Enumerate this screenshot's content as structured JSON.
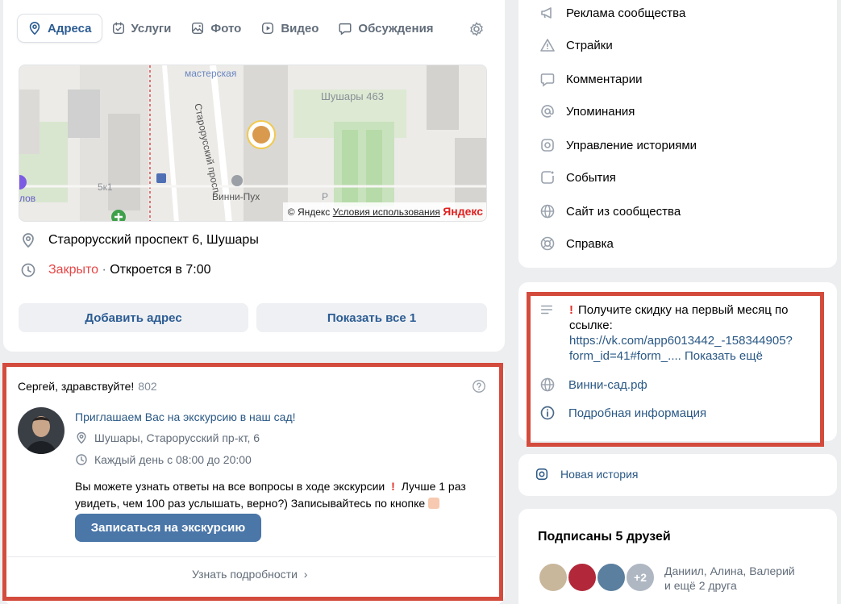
{
  "tabs": [
    {
      "label": "Адреса",
      "icon": "location-pin-icon",
      "active": true
    },
    {
      "label": "Услуги",
      "icon": "calendar-check-icon"
    },
    {
      "label": "Фото",
      "icon": "photo-icon"
    },
    {
      "label": "Видео",
      "icon": "video-play-icon"
    },
    {
      "label": "Обсуждения",
      "icon": "chat-bubble-icon"
    }
  ],
  "map": {
    "labels": {
      "workshop": "мастерская",
      "street": "Старорусский просп.",
      "district": "Шушары 463",
      "building": "5к1",
      "place": "Винни-Пух",
      "left_fragment": "лов",
      "parking": "P"
    },
    "attribution": {
      "copyright": "© Яндекс",
      "terms": "Условия использования",
      "brand": "Яндекс"
    }
  },
  "address": {
    "street": "Старорусский проспект 6, Шушары",
    "status_closed": "Закрыто",
    "status_sep": " · ",
    "status_open": "Откроется в 7:00",
    "add_button": "Добавить адрес",
    "show_all_button": "Показать все 1"
  },
  "widget": {
    "greeting": "Сергей, здравствуйте!",
    "count": "802",
    "invite": "Приглашаем Вас на экскурсию в наш сад!",
    "location": "Шушары, Старорусский пр-кт, 6",
    "schedule": "Каждый день с 08:00 до 20:00",
    "body_line1": "Вы можете узнать ответы на все вопросы в ходе экскурсии",
    "body_line1b": "Лучше 1 раз",
    "body_line2": "увидеть, чем 100 раз услышать, верно?) Записывайтесь по кнопке",
    "cta_button": "Записаться на экскурсию",
    "more_link": "Узнать подробности"
  },
  "menu": [
    {
      "label": "Реклама сообщества",
      "icon": "megaphone-icon"
    },
    {
      "label": "Страйки",
      "icon": "warning-triangle-icon"
    },
    {
      "label": "Комментарии",
      "icon": "comment-icon"
    },
    {
      "label": "Упоминания",
      "icon": "at-sign-icon"
    },
    {
      "label": "Управление историями",
      "icon": "stories-icon"
    },
    {
      "label": "События",
      "icon": "events-icon"
    },
    {
      "label": "Сайт из сообщества",
      "icon": "globe-icon"
    },
    {
      "label": "Справка",
      "icon": "lifebuoy-icon"
    }
  ],
  "info": {
    "promo_line1": "Получите скидку на первый месяц по",
    "promo_line2": "ссылке:",
    "promo_link_line1": "https://vk.com/app6013442_-158344905?",
    "promo_link_line2": "form_id=41#form_....",
    "show_more": "Показать ещё",
    "site": "Винни-сад.рф",
    "details": "Подробная информация"
  },
  "stories": {
    "new_story": "Новая история"
  },
  "friends": {
    "title": "Подписаны 5 друзей",
    "extra_badge": "+2",
    "names_line1": "Даниил, Алина, Валерий",
    "names_line2": "и ещё 2 друга"
  },
  "colors": {
    "accent": "#2c5c93",
    "link": "#2a5885",
    "closed": "#e64646",
    "frame": "#d34b3d",
    "button": "#4a76a8"
  }
}
